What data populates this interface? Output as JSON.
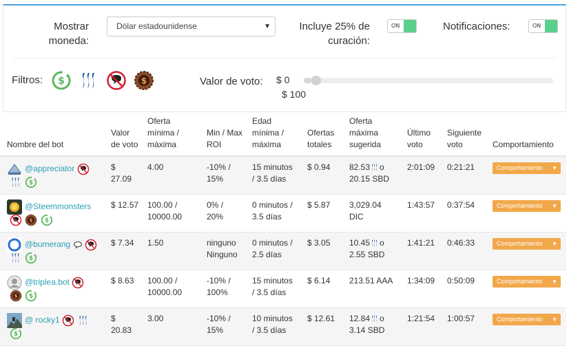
{
  "settings": {
    "currency_label": "Mostrar moneda:",
    "currency_value": "Dólar estadounidense",
    "curation_label": "Incluye 25% de curación:",
    "curation_toggle": "ON",
    "notifications_label": "Notificaciones:",
    "notifications_toggle": "ON",
    "filters_label": "Filtros:",
    "filters": [
      "sbd-filter-icon",
      "steem-filter-icon",
      "no-comments-filter-icon",
      "bid-refund-filter-icon"
    ],
    "vote_label": "Valor de voto:",
    "vote_min": "$ 0",
    "vote_max": "$ 100",
    "slider_position": 0.03
  },
  "colors": {
    "accent": "#2a9fb5",
    "behavior_button": "#f2a84a",
    "toggle_on": "#5ad08c",
    "top_border": "#4aa3df",
    "red_icon": "#d2202f"
  },
  "table": {
    "headers": {
      "name": "Nombre del bot",
      "vote_value": "Valor de voto",
      "min_max_bid": "Oferta mínima / máxima",
      "min_max_roi": "Min / Max ROI",
      "min_max_age": "Edad mínima / máxima",
      "total_bids": "Ofertas totales",
      "max_suggested": "Oferta máxima sugerida",
      "last_vote": "Último voto",
      "next_vote": "Siguiente voto",
      "behavior": "Comportamiento"
    },
    "rows": [
      {
        "name": "@appreciator",
        "avatar": "appreciator-avatar-icon",
        "vote": "$ 27.09",
        "bid_a": "4.00",
        "bid_b": "",
        "roi_a": "-10% /",
        "roi_b": "15%",
        "age_a": "15 minutos",
        "age_b": "/ 3.5 días",
        "total": "$ 0.94",
        "sugg_a": "82.53",
        "sugg_a_suffix": "o",
        "sugg_b": "20.15 SBD",
        "last": "2:01:09",
        "next": "0:21:21",
        "behavior": "Comportamiento"
      },
      {
        "name": "@Steemmonsters",
        "avatar": "steemmonsters-avatar-icon",
        "vote": "$ 12.57",
        "bid_a": "100.00 /",
        "bid_b": "10000.00",
        "roi_a": "0% /",
        "roi_b": "20%",
        "age_a": "0 minutos /",
        "age_b": "3.5 días",
        "total": "$ 5.87",
        "sugg_a": "3,029.04",
        "sugg_a_suffix": "",
        "sugg_b": "DIC",
        "last": "1:43:57",
        "next": "0:37:54",
        "behavior": "Comportamiento"
      },
      {
        "name": "@bumerang",
        "avatar": "bumerang-avatar-icon",
        "vote": "$ 7.34",
        "bid_a": "1.50",
        "bid_b": "",
        "roi_a": "ninguno",
        "roi_b": "Ninguno",
        "age_a": "0 minutos /",
        "age_b": "2.5 días",
        "total": "$ 3.05",
        "sugg_a": "10.45",
        "sugg_a_suffix": "o",
        "sugg_b": "2.55 SBD",
        "last": "1:41:21",
        "next": "0:46:33",
        "behavior": "Comportamiento"
      },
      {
        "name": "@triplea.bot",
        "avatar": "default-user-avatar-icon",
        "vote": "$ 8.63",
        "bid_a": "100.00 /",
        "bid_b": "10000.00",
        "roi_a": "-10% /",
        "roi_b": "100%",
        "age_a": "15 minutos",
        "age_b": "/ 3.5 días",
        "total": "$ 6.14",
        "sugg_a": "213.51 AAA",
        "sugg_a_suffix": "",
        "sugg_b": "",
        "last": "1:34:09",
        "next": "0:50:09",
        "behavior": "Comportamiento"
      },
      {
        "name": "@ rocky1",
        "avatar": "rocky1-avatar-icon",
        "vote": "$ 20.83",
        "bid_a": "3.00",
        "bid_b": "",
        "roi_a": "-10% /",
        "roi_b": "15%",
        "age_a": "10 minutos",
        "age_b": "/ 3.5 días",
        "total": "$ 12.61",
        "sugg_a": "12.84",
        "sugg_a_suffix": "o",
        "sugg_b": "3.14 SBD",
        "last": "1:21:54",
        "next": "1:00:57",
        "behavior": "Comportamiento"
      }
    ]
  }
}
